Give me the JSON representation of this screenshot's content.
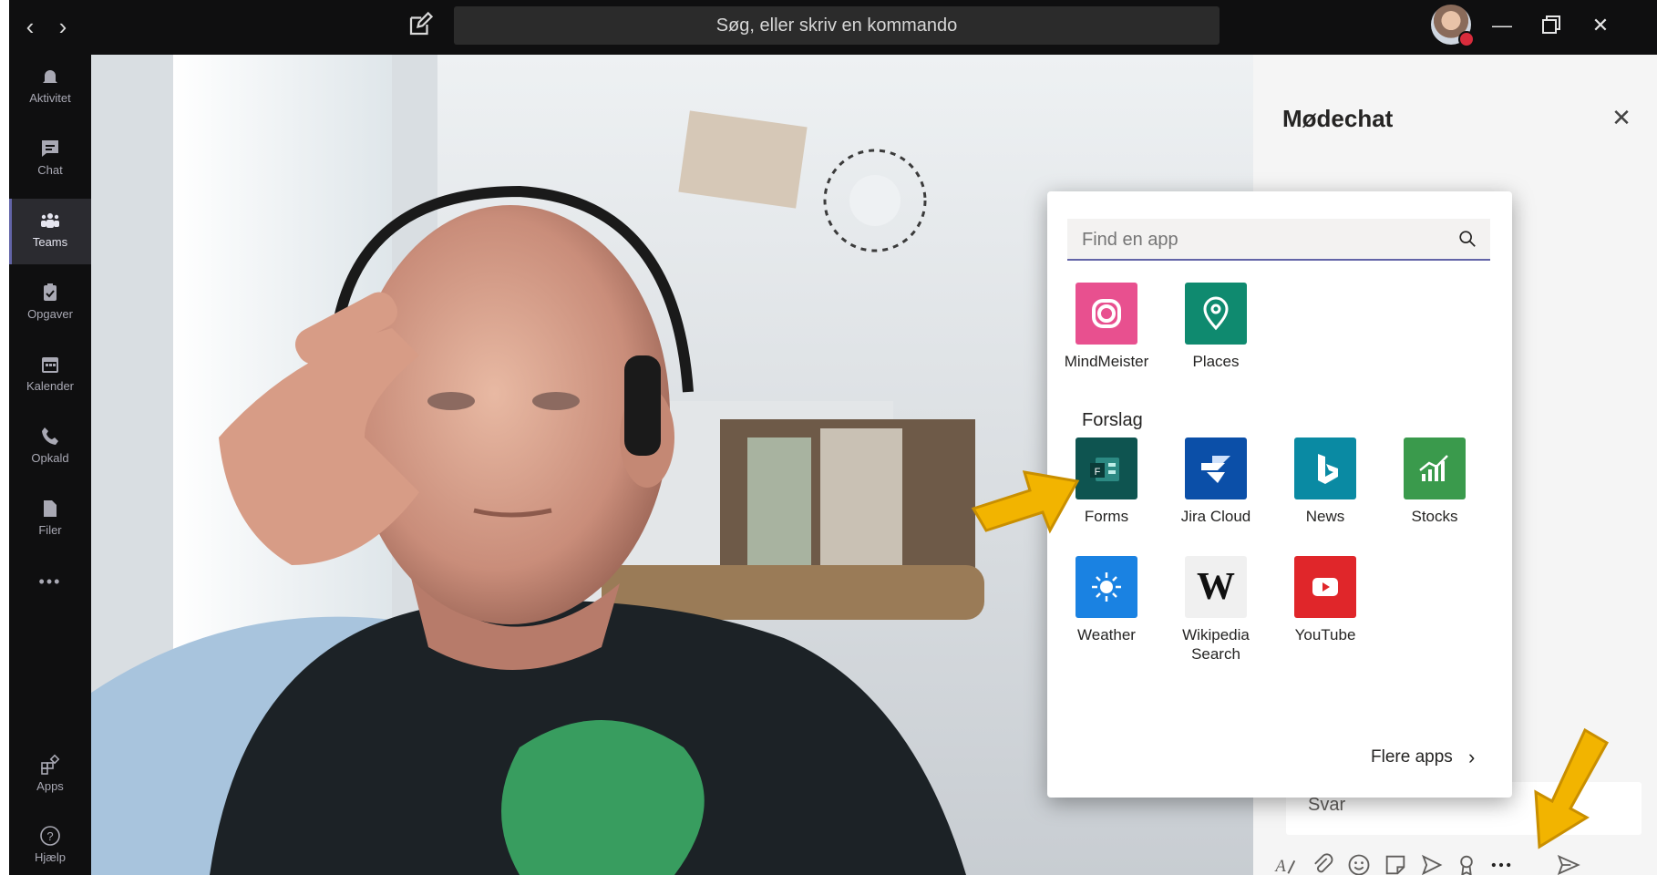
{
  "titlebar": {
    "search_placeholder": "Søg, eller skriv en kommando",
    "back_glyph": "‹",
    "forward_glyph": "›",
    "minimize_glyph": "—",
    "close_glyph": "✕"
  },
  "rail": {
    "items": [
      {
        "label": "Aktivitet",
        "icon": "bell-icon"
      },
      {
        "label": "Chat",
        "icon": "chat-icon"
      },
      {
        "label": "Teams",
        "icon": "teams-icon"
      },
      {
        "label": "Opgaver",
        "icon": "tasks-icon"
      },
      {
        "label": "Kalender",
        "icon": "calendar-icon"
      },
      {
        "label": "Opkald",
        "icon": "phone-icon"
      },
      {
        "label": "Filer",
        "icon": "file-icon"
      },
      {
        "label": "•••",
        "icon": "more-icon"
      },
      {
        "label": "Apps",
        "icon": "apps-icon"
      },
      {
        "label": "Hjælp",
        "icon": "help-icon"
      }
    ]
  },
  "chat": {
    "title": "Mødechat",
    "reply_placeholder": "Svar",
    "close_glyph": "✕"
  },
  "popup": {
    "search_placeholder": "Find en app",
    "recent_apps": [
      {
        "label": "MindMeister",
        "color": "#e8508f"
      },
      {
        "label": "Places",
        "color": "#0f8a6f"
      }
    ],
    "suggestions_heading": "Forslag",
    "suggested_apps": [
      {
        "label": "Forms",
        "color": "#0e5450"
      },
      {
        "label": "Jira Cloud",
        "color": "#0b4fa8"
      },
      {
        "label": "News",
        "color": "#0a8aa3"
      },
      {
        "label": "Stocks",
        "color": "#3a9a4c"
      },
      {
        "label": "Weather",
        "color": "#1a82e2"
      },
      {
        "label": "Wikipedia Search",
        "color": "#f0f0f0"
      },
      {
        "label": "YouTube",
        "color": "#e0262a"
      }
    ],
    "more_apps": "Flere apps",
    "wikipedia_glyph": "W"
  },
  "colors": {
    "accent": "#6264a7",
    "annotation_arrow": "#f2b400"
  }
}
